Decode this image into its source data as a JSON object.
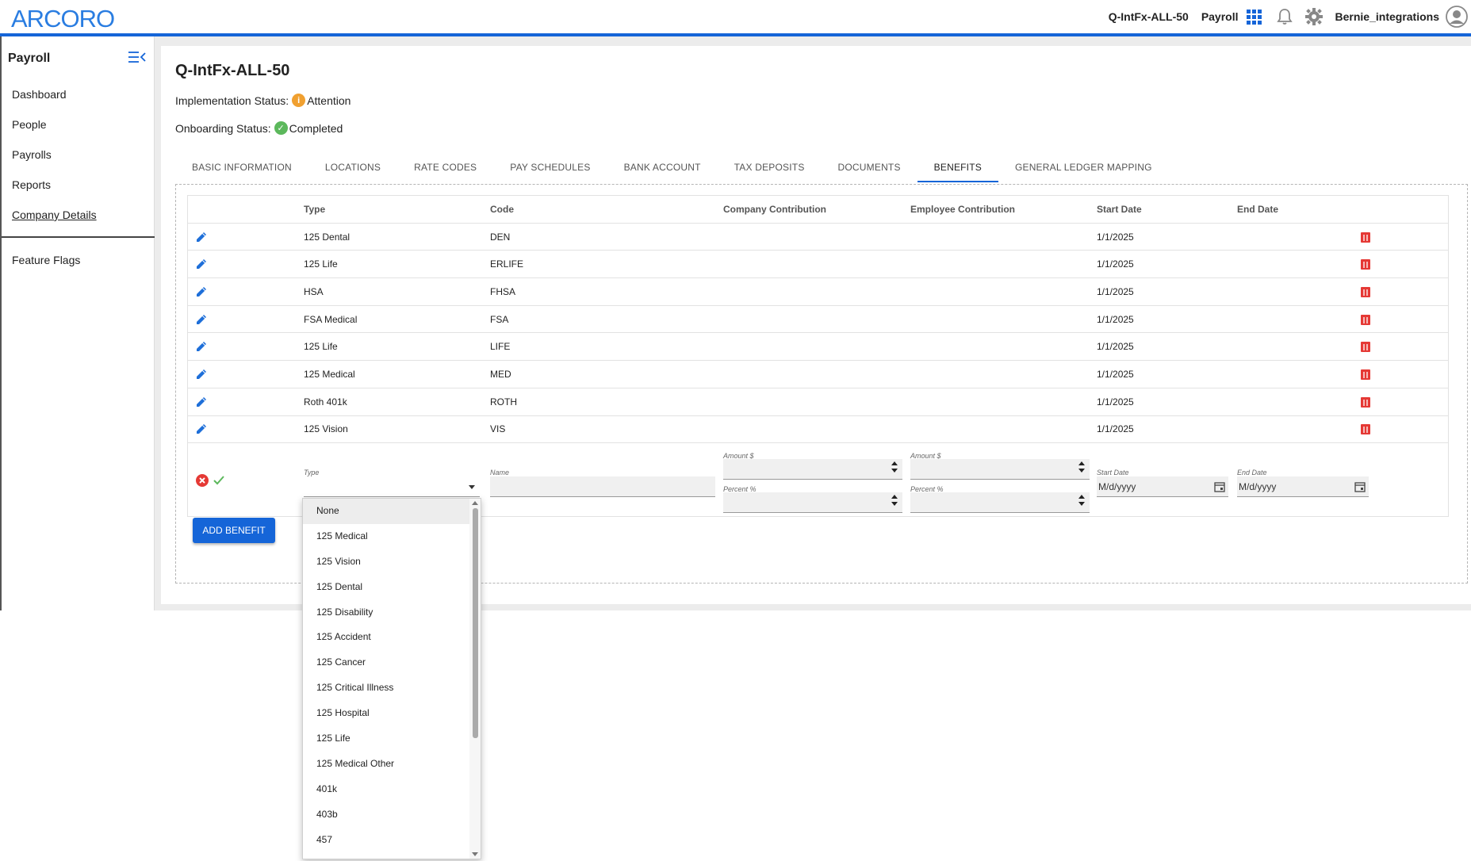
{
  "app": {
    "logo": "ARCORO"
  },
  "header": {
    "company": "Q-IntFx-ALL-50",
    "product": "Payroll",
    "user": "Bernie_integrations"
  },
  "sidebar": {
    "title": "Payroll",
    "items": [
      {
        "label": "Dashboard"
      },
      {
        "label": "People"
      },
      {
        "label": "Payrolls"
      },
      {
        "label": "Reports"
      },
      {
        "label": "Company Details"
      }
    ],
    "active": "Company Details",
    "extra": {
      "label": "Feature Flags"
    }
  },
  "page": {
    "title": "Q-IntFx-ALL-50",
    "implementation_label": "Implementation Status:",
    "implementation_value": "Attention",
    "onboarding_label": "Onboarding Status:",
    "onboarding_value": "Completed"
  },
  "tabs": [
    {
      "label": "BASIC INFORMATION"
    },
    {
      "label": "LOCATIONS"
    },
    {
      "label": "RATE CODES"
    },
    {
      "label": "PAY SCHEDULES"
    },
    {
      "label": "BANK ACCOUNT"
    },
    {
      "label": "TAX DEPOSITS"
    },
    {
      "label": "DOCUMENTS"
    },
    {
      "label": "BENEFITS"
    },
    {
      "label": "GENERAL LEDGER MAPPING"
    }
  ],
  "active_tab": "BENEFITS",
  "table": {
    "columns": [
      "Type",
      "Code",
      "Company Contribution",
      "Employee Contribution",
      "Start Date",
      "End Date"
    ],
    "rows": [
      {
        "type": "125 Dental",
        "code": "DEN",
        "company": "",
        "employee": "",
        "start": "1/1/2025",
        "end": ""
      },
      {
        "type": "125 Life",
        "code": "ERLIFE",
        "company": "",
        "employee": "",
        "start": "1/1/2025",
        "end": ""
      },
      {
        "type": "HSA",
        "code": "FHSA",
        "company": "",
        "employee": "",
        "start": "1/1/2025",
        "end": ""
      },
      {
        "type": "FSA Medical",
        "code": "FSA",
        "company": "",
        "employee": "",
        "start": "1/1/2025",
        "end": ""
      },
      {
        "type": "125 Life",
        "code": "LIFE",
        "company": "",
        "employee": "",
        "start": "1/1/2025",
        "end": ""
      },
      {
        "type": "125 Medical",
        "code": "MED",
        "company": "",
        "employee": "",
        "start": "1/1/2025",
        "end": ""
      },
      {
        "type": "Roth 401k",
        "code": "ROTH",
        "company": "",
        "employee": "",
        "start": "1/1/2025",
        "end": ""
      },
      {
        "type": "125 Vision",
        "code": "VIS",
        "company": "",
        "employee": "",
        "start": "1/1/2025",
        "end": ""
      }
    ]
  },
  "edit_row": {
    "type_label": "Type",
    "type_value": "",
    "name_label": "Name",
    "name_value": "",
    "amount_label": "Amount $",
    "percent_label": "Percent %",
    "start_label": "Start Date",
    "start_placeholder": "M/d/yyyy",
    "end_label": "End Date",
    "end_placeholder": "M/d/yyyy"
  },
  "add_button": "ADD BENEFIT",
  "dropdown": {
    "selected": "None",
    "options": [
      "None",
      "125 Medical",
      "125 Vision",
      "125 Dental",
      "125 Disability",
      "125 Accident",
      "125 Cancer",
      "125 Critical Illness",
      "125 Hospital",
      "125 Life",
      "125 Medical Other",
      "401k",
      "403b",
      "457"
    ]
  },
  "colors": {
    "accent": "#1565d8",
    "danger": "#e53935",
    "success": "#5cb85c",
    "warning": "#f0a030"
  }
}
